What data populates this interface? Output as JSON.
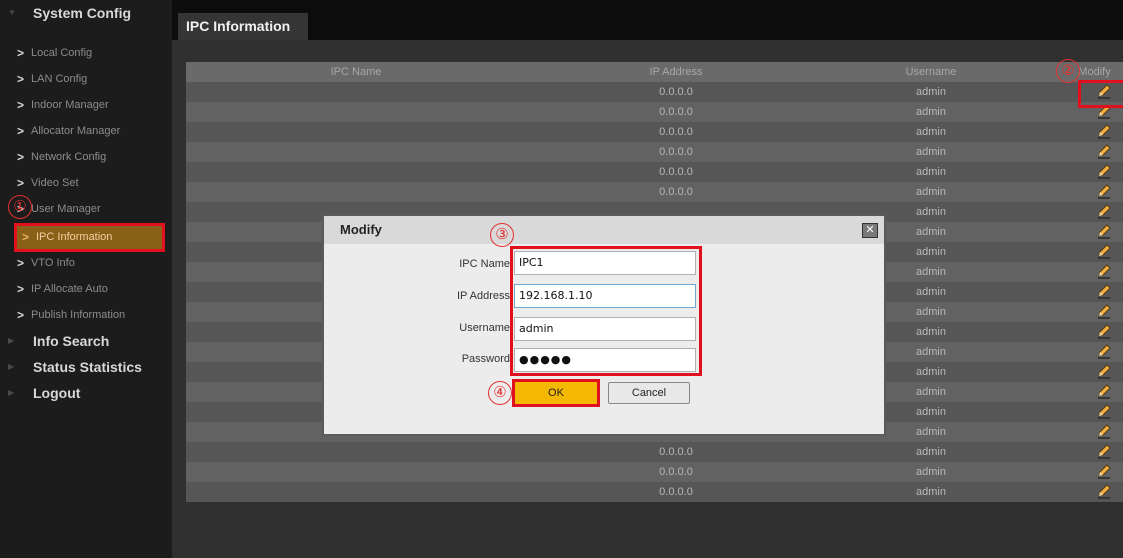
{
  "sidebar": {
    "sections": [
      {
        "label": "System Config"
      },
      {
        "label": "Info Search"
      },
      {
        "label": "Status Statistics"
      },
      {
        "label": "Logout"
      }
    ],
    "items": [
      {
        "label": "Local Config"
      },
      {
        "label": "LAN Config"
      },
      {
        "label": "Indoor Manager"
      },
      {
        "label": "Allocator Manager"
      },
      {
        "label": "Network Config"
      },
      {
        "label": "Video Set"
      },
      {
        "label": "User Manager"
      },
      {
        "label": "IPC Information"
      },
      {
        "label": "VTO Info"
      },
      {
        "label": "IP Allocate Auto"
      },
      {
        "label": "Publish Information"
      }
    ]
  },
  "tab": {
    "label": "IPC Information"
  },
  "table": {
    "headers": [
      "IPC Name",
      "IP Address",
      "Username",
      "Modify"
    ],
    "rows": [
      {
        "name": "",
        "ip": "0.0.0.0",
        "user": "admin"
      },
      {
        "name": "",
        "ip": "0.0.0.0",
        "user": "admin"
      },
      {
        "name": "",
        "ip": "0.0.0.0",
        "user": "admin"
      },
      {
        "name": "",
        "ip": "0.0.0.0",
        "user": "admin"
      },
      {
        "name": "",
        "ip": "0.0.0.0",
        "user": "admin"
      },
      {
        "name": "",
        "ip": "0.0.0.0",
        "user": "admin"
      },
      {
        "name": "",
        "ip": "",
        "user": "admin"
      },
      {
        "name": "",
        "ip": "",
        "user": "admin"
      },
      {
        "name": "",
        "ip": "",
        "user": "admin"
      },
      {
        "name": "",
        "ip": "",
        "user": "admin"
      },
      {
        "name": "",
        "ip": "",
        "user": "admin"
      },
      {
        "name": "",
        "ip": "",
        "user": "admin"
      },
      {
        "name": "",
        "ip": "",
        "user": "admin"
      },
      {
        "name": "",
        "ip": "",
        "user": "admin"
      },
      {
        "name": "",
        "ip": "",
        "user": "admin"
      },
      {
        "name": "",
        "ip": "",
        "user": "admin"
      },
      {
        "name": "",
        "ip": "0.0.0.0",
        "user": "admin"
      },
      {
        "name": "",
        "ip": "0.0.0.0",
        "user": "admin"
      },
      {
        "name": "",
        "ip": "0.0.0.0",
        "user": "admin"
      },
      {
        "name": "",
        "ip": "0.0.0.0",
        "user": "admin"
      },
      {
        "name": "",
        "ip": "0.0.0.0",
        "user": "admin"
      }
    ]
  },
  "dialog": {
    "title": "Modify",
    "close_icon": "close-icon",
    "fields": [
      {
        "label": "IPC Name",
        "value": "IPC1"
      },
      {
        "label": "IP Address",
        "value": "192.168.1.10"
      },
      {
        "label": "Username",
        "value": "admin"
      },
      {
        "label": "Password",
        "value": "●●●●●"
      }
    ],
    "ok_label": "OK",
    "cancel_label": "Cancel"
  },
  "annotations": [
    "①",
    "②",
    "③",
    "④"
  ],
  "colors": {
    "highlight": "#e0101e",
    "active_item": "#8a5f18",
    "ok_button": "#f5b800"
  }
}
